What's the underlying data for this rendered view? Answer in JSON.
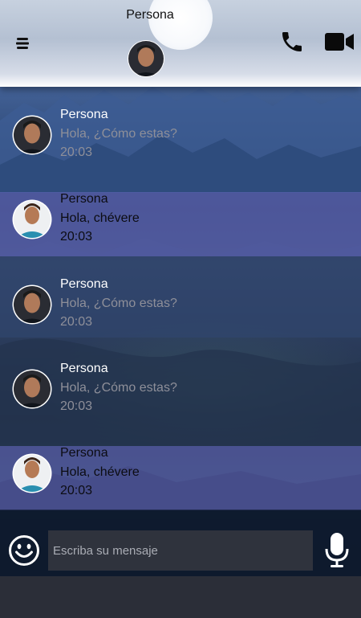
{
  "header": {
    "title": "Persona",
    "menu_icon": "hamburger-icon",
    "call_icon": "phone-icon",
    "video_icon": "video-camera-icon"
  },
  "messages": [
    {
      "type": "sent",
      "name": "Persona",
      "text": "Hola, ¿Cómo estas?",
      "time": "20:03"
    },
    {
      "type": "received",
      "name": "Persona",
      "text": "Hola, chévere",
      "time": "20:03"
    },
    {
      "type": "sent",
      "name": "Persona",
      "text": "Hola, ¿Cómo estas?",
      "time": "20:03"
    },
    {
      "type": "sent",
      "name": "Persona",
      "text": "Hola, ¿Cómo estas?",
      "time": "20:03"
    },
    {
      "type": "received",
      "name": "Persona",
      "text": "Hola, chévere",
      "time": "20:03"
    }
  ],
  "composer": {
    "placeholder": "Escriba su mensaje",
    "value": "",
    "emoji_icon": "smiley-icon",
    "mic_icon": "microphone-icon"
  },
  "colors": {
    "received_bubble": "#6266bc",
    "input_bg": "#2f333d",
    "bottom_bar": "#2b2e38"
  }
}
